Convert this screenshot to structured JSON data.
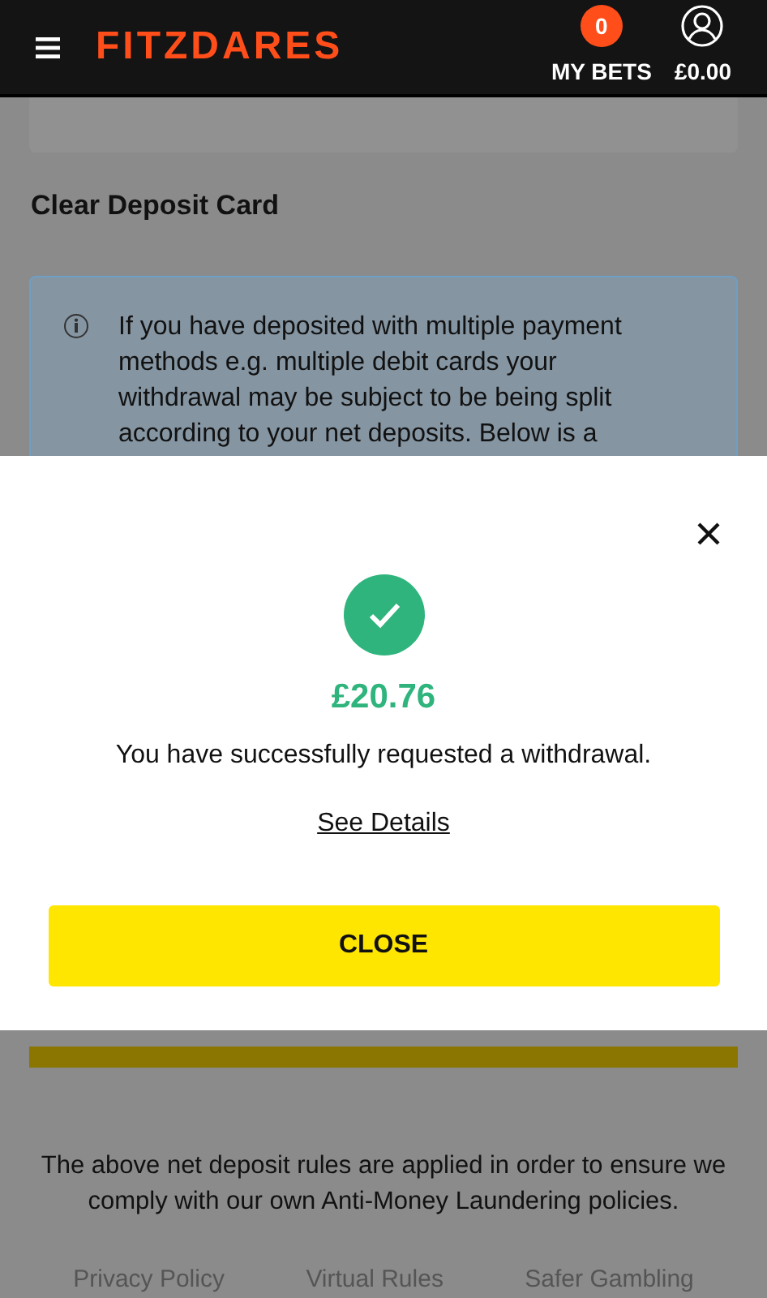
{
  "header": {
    "logo": "FITZDARES",
    "bets_count": "0",
    "my_bets": "MY BETS",
    "balance": "£0.00"
  },
  "page": {
    "section_title": "Clear Deposit Card",
    "info_text": "If you have deposited with multiple payment methods e.g. multiple debit cards your withdrawal may be subject to be being split according to your net deposits. Below is a",
    "footer_note": "The above net deposit rules are applied in order to ensure we comply with our own Anti-Money Laundering policies.",
    "footer_links": [
      "Privacy Policy",
      "Virtual Rules",
      "Safer Gambling"
    ]
  },
  "modal": {
    "amount": "£20.76",
    "message": "You have successfully requested a withdrawal.",
    "details_link": "See Details",
    "button": "CLOSE"
  }
}
